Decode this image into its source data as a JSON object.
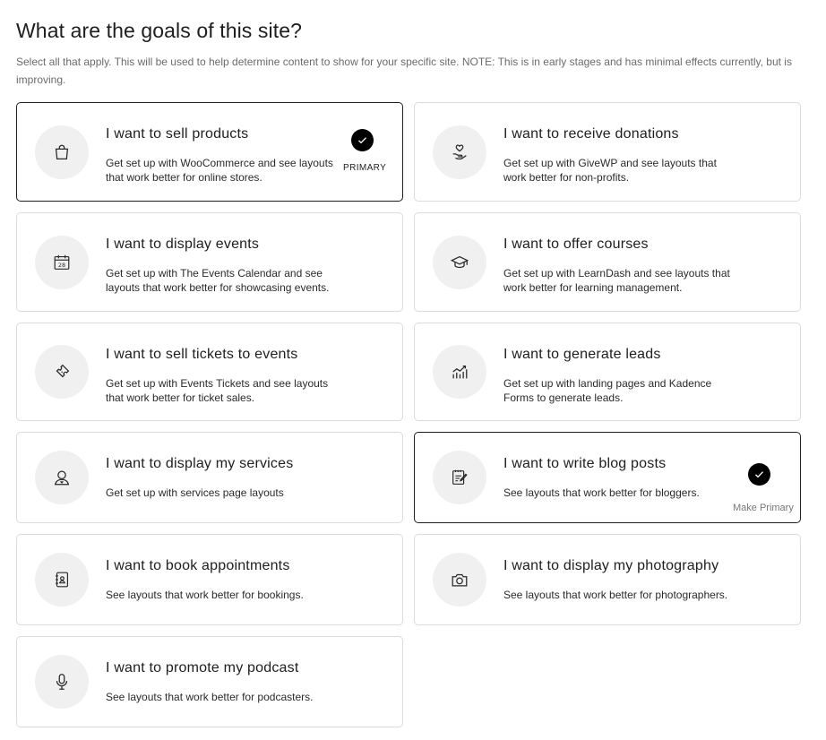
{
  "header": {
    "title": "What are the goals of this site?",
    "description": "Select all that apply. This will be used to help determine content to show for your specific site. NOTE: This is in early stages and has minimal effects currently, but is improving."
  },
  "goals": [
    {
      "title": "I want to sell products",
      "desc": "Get set up with WooCommerce and see layouts that work better for online stores.",
      "icon": "shopping-bag-icon",
      "selected": true,
      "primary_label": "PRIMARY"
    },
    {
      "title": "I want to receive donations",
      "desc": "Get set up with GiveWP and see layouts that work better for non-profits.",
      "icon": "donation-hand-icon",
      "selected": false
    },
    {
      "title": "I want to display events",
      "desc": "Get set up with The Events Calendar and see layouts that work better for showcasing events.",
      "icon": "calendar-icon",
      "selected": false,
      "calendar_day": "28"
    },
    {
      "title": "I want to offer courses",
      "desc": "Get set up with LearnDash and see layouts that work better for learning management.",
      "icon": "graduation-cap-icon",
      "selected": false
    },
    {
      "title": "I want to sell tickets to events",
      "desc": "Get set up with Events Tickets and see layouts that work better for ticket sales.",
      "icon": "ticket-icon",
      "selected": false
    },
    {
      "title": "I want to generate leads",
      "desc": "Get set up with landing pages and Kadence Forms to generate leads.",
      "icon": "chart-growth-icon",
      "selected": false
    },
    {
      "title": "I want to display my services",
      "desc": "Get set up with services page layouts",
      "icon": "person-icon",
      "selected": false
    },
    {
      "title": "I want to write blog posts",
      "desc": "See layouts that work better for bloggers.",
      "icon": "notepad-pen-icon",
      "selected": true,
      "make_primary_label": "Make Primary"
    },
    {
      "title": "I want to book appointments",
      "desc": "See layouts that work better for bookings.",
      "icon": "contact-book-icon",
      "selected": false
    },
    {
      "title": "I want to display my photography",
      "desc": "See layouts that work better for photographers.",
      "icon": "camera-icon",
      "selected": false
    },
    {
      "title": "I want to promote my podcast",
      "desc": "See layouts that work better for podcasters.",
      "icon": "microphone-icon",
      "selected": false
    }
  ],
  "colors": {
    "selected_border": "#1e1e1e",
    "card_border": "#dcdcdc",
    "icon_bg": "#f0f0f0",
    "check_bg": "#000000"
  }
}
